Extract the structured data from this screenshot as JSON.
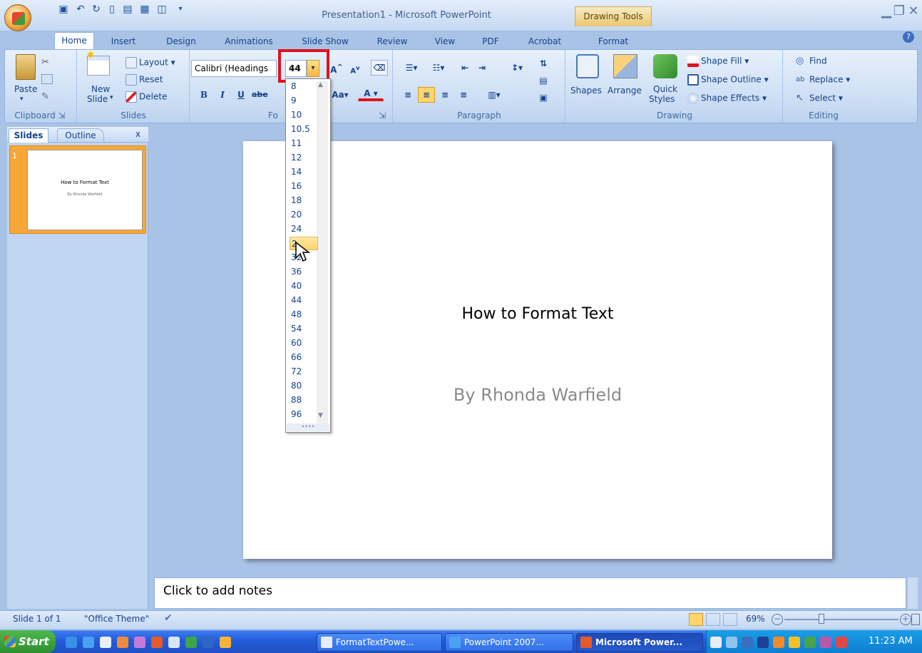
{
  "window": {
    "title": "Presentation1 - Microsoft PowerPoint",
    "contextual_tab_group": "Drawing Tools",
    "help_glyph": "?"
  },
  "tabs": [
    "Home",
    "Insert",
    "Design",
    "Animations",
    "Slide Show",
    "Review",
    "View",
    "PDF",
    "Acrobat",
    "Format"
  ],
  "ribbon": {
    "clipboard": {
      "label": "Clipboard",
      "paste": "Paste"
    },
    "slides": {
      "label": "Slides",
      "new_slide_1": "New",
      "new_slide_2": "Slide",
      "layout": "Layout",
      "reset": "Reset",
      "delete": "Delete"
    },
    "font": {
      "label": "Font",
      "label_visible": "Fo",
      "font_name": "Calibri (Headings",
      "font_size": "44",
      "bold": "B",
      "italic": "I",
      "underline": "U",
      "strike": "abe",
      "change_case": "Aa",
      "font_color": "A",
      "grow": "A",
      "shrink": "A"
    },
    "paragraph": {
      "label": "Paragraph"
    },
    "drawing": {
      "label": "Drawing",
      "shapes": "Shapes",
      "arrange": "Arrange",
      "quick_styles_1": "Quick",
      "quick_styles_2": "Styles",
      "shape_fill": "Shape Fill",
      "shape_outline": "Shape Outline",
      "shape_effects": "Shape Effects"
    },
    "editing": {
      "label": "Editing",
      "find": "Find",
      "replace": "Replace",
      "select": "Select"
    }
  },
  "font_size_dropdown": {
    "options": [
      "8",
      "9",
      "10",
      "10.5",
      "11",
      "12",
      "14",
      "16",
      "18",
      "20",
      "24",
      "28",
      "32",
      "36",
      "40",
      "44",
      "48",
      "54",
      "60",
      "66",
      "72",
      "80",
      "88",
      "96"
    ],
    "highlighted": "28",
    "highlighted_visible": "2"
  },
  "left_pane": {
    "tab_slides": "Slides",
    "tab_outline": "Outline",
    "close": "x",
    "slide_number": "1",
    "thumb_title": "How to Format Text",
    "thumb_subtitle": "By Rhonda Warfield"
  },
  "slide": {
    "title": "How to Format Text",
    "subtitle": "By Rhonda Warfield"
  },
  "notes": {
    "placeholder": "Click to add notes"
  },
  "status": {
    "slide_info": "Slide 1 of 1",
    "theme": "\"Office Theme\"",
    "zoom": "69%"
  },
  "taskbar": {
    "start": "Start",
    "tasks": [
      "FormatTextPowe...",
      "PowerPoint 2007...",
      "Microsoft Power..."
    ],
    "clock": "11:23 AM"
  },
  "colors": {
    "accent_red": "#e0121c",
    "ribbon_text": "#15428b",
    "slide_thumb_highlight": "#f7a737"
  }
}
